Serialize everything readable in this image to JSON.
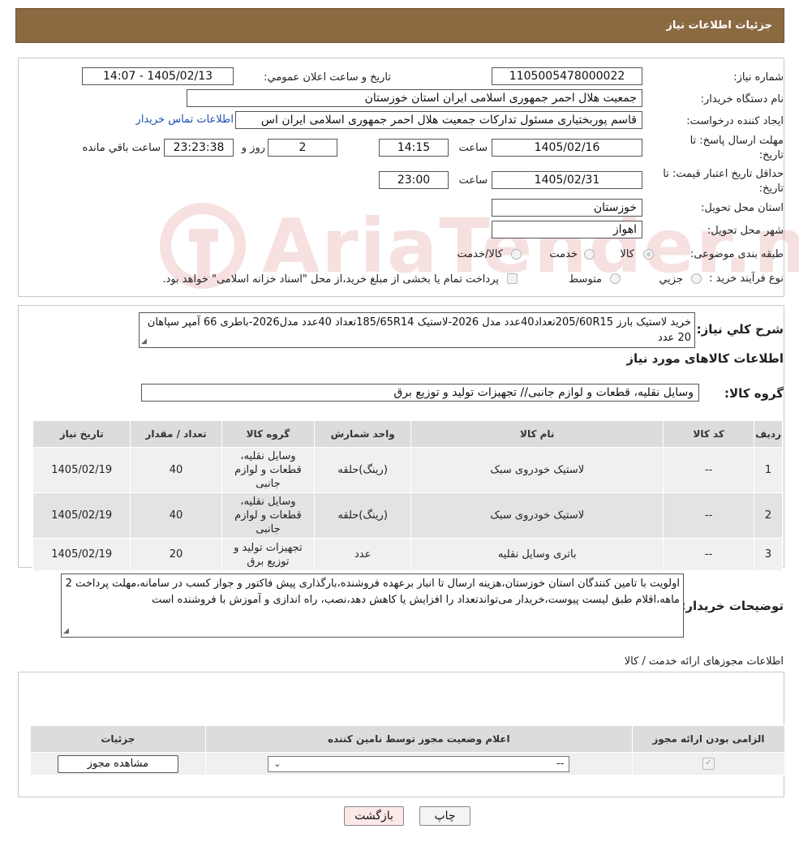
{
  "header": {
    "title": "جزئیات اطلاعات نیاز"
  },
  "form": {
    "need_number_label": "شماره نیاز:",
    "need_number": "1105005478000022",
    "announce_label": "تاریخ و ساعت اعلان عمومي:",
    "announce_value": "1405/02/13 - 14:07",
    "buyer_org_label": "نام دستگاه خریدار:",
    "buyer_org": "جمعیت هلال احمر جمهوری اسلامی ایران استان خوزستان",
    "creator_label": "ایجاد کننده درخواست:",
    "creator": "قاسم پوربختیاری مسئول تدارکات جمعیت هلال احمر جمهوری اسلامی ایران اس",
    "contact_link": "اطلاعات تماس خریدار",
    "deadline_label_1": "مهلت ارسال پاسخ: تا",
    "deadline_label_2": "تاریخ:",
    "deadline_date": "1405/02/16",
    "time_label": "ساعت",
    "deadline_time": "14:15",
    "days_value": "2",
    "days_label": "روز و",
    "remaining_time": "23:23:38",
    "remaining_label": "ساعت باقي مانده",
    "validity_label_1": "حداقل تاریخ اعتبار قیمت: تا",
    "validity_label_2": "تاریخ:",
    "validity_date": "1405/02/31",
    "validity_time": "23:00",
    "province_label": "استان محل تحویل:",
    "province": "خوزستان",
    "city_label": "شهر محل تحویل:",
    "city": "اهواز",
    "category_label": "طبقه بندی موضوعی:",
    "category_options": [
      "کالا",
      "خدمت",
      "کالا/خدمت"
    ],
    "process_label": "نوع فرآیند خرید :",
    "process_options": [
      "جزيي",
      "متوسط"
    ],
    "process_note": "پرداخت تمام یا بخشی از مبلغ خرید،از محل \"اسناد خزانه اسلامی\" خواهد بود."
  },
  "watermark": {
    "text": "AriaTender.neT"
  },
  "summary": {
    "label": "شرح کلي نیاز:",
    "text": "خرید لاستیک بارز 205/60R15تعداد40عدد مدل 2026-لاستیک 185/65R14تعداد 40عدد مدل2026-باطری 66 آمپر سپاهان 20 عدد",
    "goods_info_title": "اطلاعات کالاهای مورد نیاز",
    "group_label": "گروه کالا:",
    "group_value": "وسایل نقلیه، قطعات و لوازم جانبی// تجهیزات تولید و توزیع برق"
  },
  "goods_table": {
    "headers": [
      "ردیف",
      "کد کالا",
      "نام کالا",
      "واحد شمارش",
      "گروه کالا",
      "تعداد / مقدار",
      "تاریخ نیاز"
    ],
    "rows": [
      {
        "idx": "1",
        "code": "--",
        "name": "لاستیک خودروی سبک",
        "unit": "(رینگ)حلقه",
        "group": "وسایل نقلیه، قطعات و لوازم جانبی",
        "qty": "40",
        "date": "1405/02/19"
      },
      {
        "idx": "2",
        "code": "--",
        "name": "لاستیک خودروی سبک",
        "unit": "(رینگ)حلقه",
        "group": "وسایل نقلیه، قطعات و لوازم جانبی",
        "qty": "40",
        "date": "1405/02/19"
      },
      {
        "idx": "3",
        "code": "--",
        "name": "باتری وسایل نقلیه",
        "unit": "عدد",
        "group": "تجهیزات تولید و توزیع برق",
        "qty": "20",
        "date": "1405/02/19"
      }
    ]
  },
  "buyer_notes": {
    "label": "توضیحات خریدار:",
    "text": "اولویت با تامین کنندگان استان خوزستان،هزینه ارسال تا انبار برعهده فروشنده،بارگذاری پیش فاکتور و جواز کسب در سامانه،مهلت پرداخت 2 ماهه،اقلام طبق لیست پیوست،خریدار می‌تواندتعداد را افزایش یا کاهش دهد،نصب، راه اندازی و آموزش با فروشنده است"
  },
  "permits": {
    "title": "اطلاعات مجوزهای ارائه خدمت / کالا",
    "headers": [
      "الزامی بودن ارائه مجوز",
      "اعلام وضعیت مجوز توسط نامین کننده",
      "جزئیات"
    ],
    "select_value": "--",
    "view_button": "مشاهده مجوز"
  },
  "footer": {
    "print_button": "چاپ",
    "back_button": "بازگشت"
  }
}
